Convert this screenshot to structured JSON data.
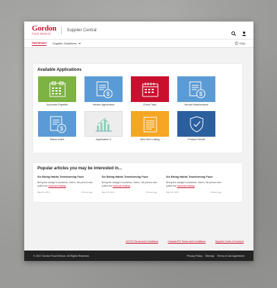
{
  "header": {
    "logo_word": "Gordon",
    "logo_sub": "FOOD SERVICE",
    "app_title": "Supplier Central"
  },
  "nav": {
    "dashboard": "Dashboard",
    "supplier_guidelines": "Supplier Guidelines",
    "faq": "FAQ"
  },
  "apps": {
    "title": "Available Applications",
    "items": [
      {
        "label": "Accounts Payable",
        "color": "#7cb342",
        "icon": "calculator-icon"
      },
      {
        "label": "Vendor Agreement",
        "color": "#5b9bd5",
        "icon": "document-dollar-icon"
      },
      {
        "label": "Event Task",
        "color": "#c8102e",
        "icon": "calendar-icon"
      },
      {
        "label": "Vendor Maintenance",
        "color": "#5b9bd5",
        "icon": "document-dollar-icon"
      },
      {
        "label": "Bravo Index",
        "color": "#5b9bd5",
        "icon": "document-dollar-icon"
      },
      {
        "label": "Application X",
        "color": "#e8e8e8",
        "icon": "bar-chart-icon"
      },
      {
        "label": "New Item Listing",
        "color": "#f5a623",
        "icon": "list-icon"
      },
      {
        "label": "Product Recall",
        "color": "#2c5f9e",
        "icon": "shield-check-icon"
      }
    ]
  },
  "articles": {
    "title": "Popular articles you may be interested in...",
    "items": [
      {
        "title": "Six Eating Habits Transforming Food",
        "body": "Being the savage's bowsman, that is, the person who pulled the",
        "more": "continue reading",
        "date": "May 22, 2017",
        "ago": "8 hours ago"
      },
      {
        "title": "Six Eating Habits Transforming Food",
        "body": "Being the savage's bowsman, that is, the person who pulled the",
        "more": "continue reading",
        "date": "May 22, 2017",
        "ago": "8 hours ago"
      },
      {
        "title": "Six Eating Habits Transforming Food",
        "body": "Being the savage's bowsman, that is, the person who pulled the",
        "more": "continue reading",
        "date": "May 22, 2017",
        "ago": "8 hours ago"
      }
    ]
  },
  "terms_links": [
    "US PO Terms and Conditions",
    "Canada PO Terms and Conditions",
    "Supplier Code of Conduct"
  ],
  "footer": {
    "copyright": "© 2017 Gordon Food Service. All Rights Reserved.",
    "links": [
      "Privacy Policy",
      "Sitemap",
      "Terms of Use Agreement"
    ]
  }
}
